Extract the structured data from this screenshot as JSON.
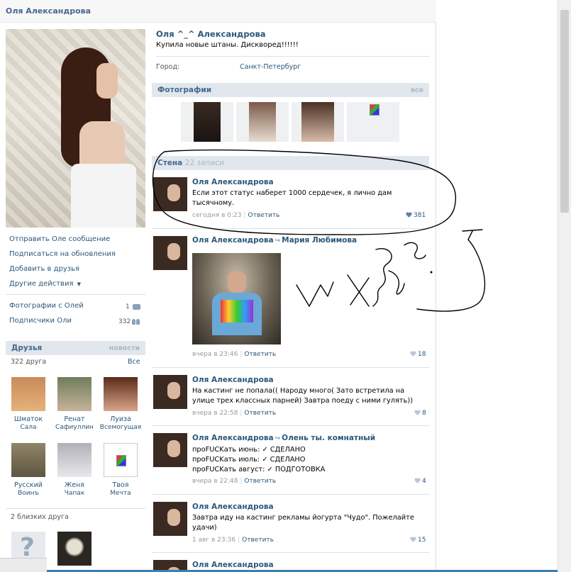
{
  "profile": {
    "title": "Оля Александрова",
    "name": "Оля ^_^ Александрова",
    "status": "Купила новые штаны. Дискворед!!!!!!",
    "city_label": "Город:",
    "city_value": "Санкт-Петербург"
  },
  "sidebar": {
    "actions": [
      "Отправить Оле сообщение",
      "Подписаться на обновления",
      "Добавить в друзья",
      "Другие действия"
    ],
    "photos_with": {
      "label": "Фотографии с Олей",
      "count": "1"
    },
    "subscribers": {
      "label": "Подписчики Оли",
      "count": "332"
    },
    "friends": {
      "header": "Друзья",
      "news_link": "новости",
      "count_label": "322 друга",
      "all_link": "Все",
      "items": [
        {
          "first": "Шматок",
          "last": "Сала"
        },
        {
          "first": "Ренат",
          "last": "Сафиуллин"
        },
        {
          "first": "Луиза",
          "last": "Всемогущая"
        },
        {
          "first": "Русский",
          "last": "Воинъ"
        },
        {
          "first": "Женя",
          "last": "Чапак"
        },
        {
          "first": "Твоя",
          "last": "Мечта"
        }
      ]
    },
    "close_friends_label": "2 близких друга"
  },
  "photos": {
    "header": "Фотографии",
    "all_link": "все"
  },
  "wall": {
    "header": "Стена",
    "count": "22 записи",
    "posts": [
      {
        "author": "Оля Александрова",
        "repost_from": "",
        "text": [
          "Если этот статус наберет 1000 сердечек, я лично дам",
          "тысячному."
        ],
        "time": "сегодня в 0:23",
        "reply": "Ответить",
        "likes": "381"
      },
      {
        "author": "Оля Александрова",
        "repost_from": "Мария Любимова",
        "text": [],
        "time": "вчера в 23:46",
        "reply": "Ответить",
        "likes": "18"
      },
      {
        "author": "Оля Александрова",
        "repost_from": "",
        "text": [
          "На кастинг не попала(( Народу много( Зато встретила на",
          "улице трех классных парней) Завтра поеду с ними гулять))"
        ],
        "time": "вчера в 22:58",
        "reply": "Ответить",
        "likes": "8"
      },
      {
        "author": "Оля Александрова",
        "repost_from": "Олень ты. комнатный",
        "text": [
          "проFUCKать июнь: ✓ СДЕЛАНО",
          "проFUCKать июль: ✓ СДЕЛАНО",
          "проFUCKать август: ✓ ПОДГОТОВКА"
        ],
        "time": "вчера в 22:48",
        "reply": "Ответить",
        "likes": "4"
      },
      {
        "author": "Оля Александрова",
        "repost_from": "",
        "text": [
          "Завтра иду на кастинг рекламы йогурта \"Чудо\". Пожелайте",
          "удачи)"
        ],
        "time": "1 авг в 23:36",
        "reply": "Ответить",
        "likes": "15"
      },
      {
        "author": "Оля Александрова",
        "repost_from": "",
        "text": [],
        "time": "",
        "reply": "",
        "likes": ""
      }
    ]
  },
  "colors": {
    "link": "#2b587a",
    "section_bg": "#e1e7ed",
    "section_text": "#45688e",
    "muted": "#999999"
  }
}
